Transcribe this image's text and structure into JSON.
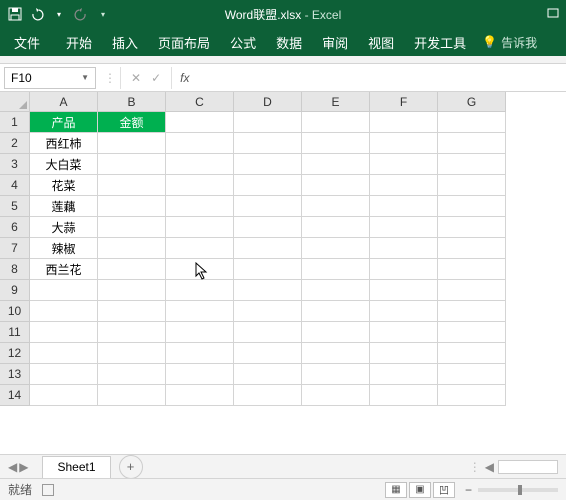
{
  "titlebar": {
    "filename": "Word联盟.xlsx",
    "app": "Excel"
  },
  "ribbon": {
    "tabs": [
      "文件",
      "开始",
      "插入",
      "页面布局",
      "公式",
      "数据",
      "审阅",
      "视图",
      "开发工具"
    ],
    "tell_me": "告诉我"
  },
  "namebox": {
    "value": "F10"
  },
  "formula": {
    "fx": "fx"
  },
  "columns": [
    "A",
    "B",
    "C",
    "D",
    "E",
    "F",
    "G"
  ],
  "rows": [
    "1",
    "2",
    "3",
    "4",
    "5",
    "6",
    "7",
    "8",
    "9",
    "10",
    "11",
    "12",
    "13",
    "14"
  ],
  "data": {
    "header": {
      "a": "产品",
      "b": "金额"
    },
    "items": [
      "西红柿",
      "大白菜",
      "花菜",
      "莲藕",
      "大蒜",
      "辣椒",
      "西兰花"
    ]
  },
  "sheet": {
    "name": "Sheet1"
  },
  "status": {
    "ready": "就绪"
  },
  "icons": {
    "save": "save-icon",
    "undo": "undo-icon",
    "redo": "redo-icon",
    "close": "×",
    "restore": "❐",
    "bulb": "💡",
    "plus": "+",
    "minus": "−"
  },
  "colors": {
    "accent": "#0d6037",
    "header_fill": "#00b050"
  }
}
